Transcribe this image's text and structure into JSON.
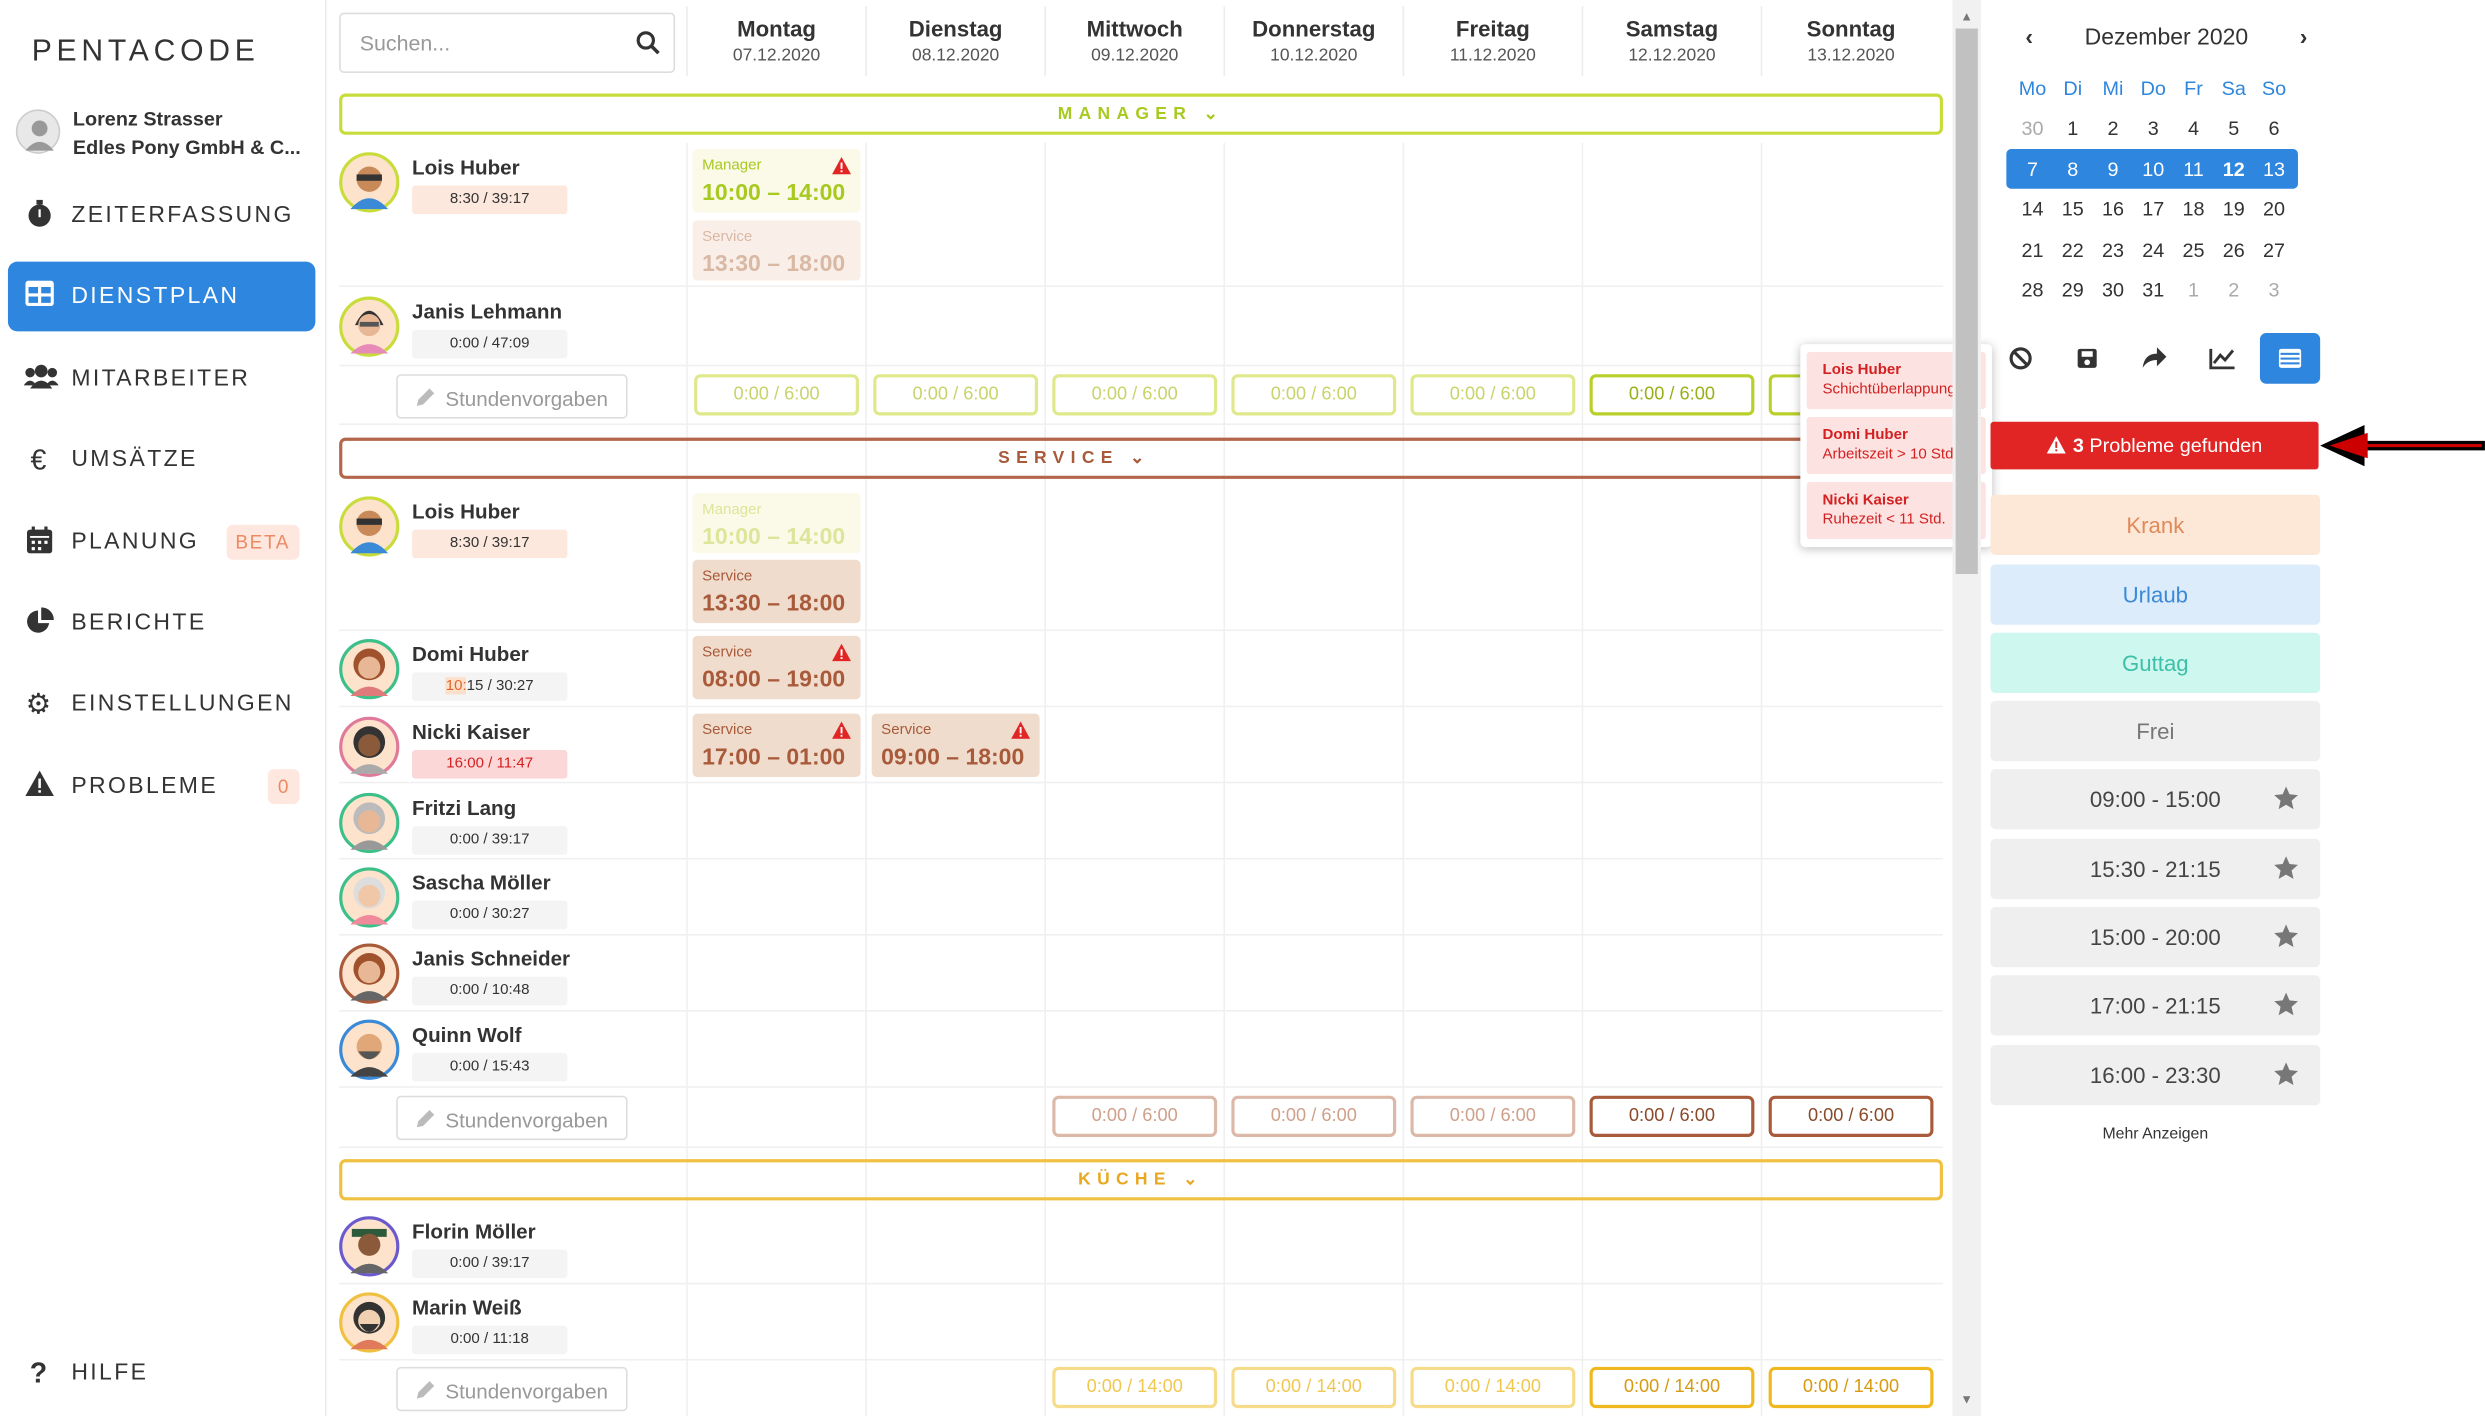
{
  "app": {
    "logo": "PENTACODE"
  },
  "user": {
    "name": "Lorenz Strasser",
    "company": "Edles Pony GmbH & C..."
  },
  "nav": {
    "items": [
      {
        "label": "ZEITERFASSUNG",
        "icon": "stopwatch-icon"
      },
      {
        "label": "DIENSTPLAN",
        "icon": "table-icon",
        "active": true
      },
      {
        "label": "MITARBEITER",
        "icon": "users-icon"
      },
      {
        "label": "UMSÄTZE",
        "icon": "euro-icon"
      },
      {
        "label": "PLANUNG",
        "icon": "calendar-icon",
        "badge": "BETA"
      },
      {
        "label": "BERICHTE",
        "icon": "pie-chart-icon"
      },
      {
        "label": "EINSTELLUNGEN",
        "icon": "gear-icon"
      },
      {
        "label": "PROBLEME",
        "icon": "warning-icon",
        "badge": "0"
      }
    ],
    "help": "HILFE"
  },
  "search": {
    "placeholder": "Suchen..."
  },
  "days": [
    {
      "name": "Montag",
      "date": "07.12.2020"
    },
    {
      "name": "Dienstag",
      "date": "08.12.2020"
    },
    {
      "name": "Mittwoch",
      "date": "09.12.2020"
    },
    {
      "name": "Donnerstag",
      "date": "10.12.2020"
    },
    {
      "name": "Freitag",
      "date": "11.12.2020"
    },
    {
      "name": "Samstag",
      "date": "12.12.2020"
    },
    {
      "name": "Sonntag",
      "date": "13.12.2020"
    }
  ],
  "groups": {
    "manager": {
      "label": "MANAGER",
      "color": "#a8c920"
    },
    "service": {
      "label": "SERVICE",
      "color": "#a85a3a"
    },
    "kueche": {
      "label": "KÜCHE",
      "color": "#f0b820"
    }
  },
  "stundenvorgaben": "Stundenvorgaben",
  "employees": {
    "m_lois": {
      "name": "Lois Huber",
      "hours": "8:30 / 39:17"
    },
    "m_janis": {
      "name": "Janis Lehmann",
      "hours": "0:00 / 47:09"
    },
    "s_lois": {
      "name": "Lois Huber",
      "hours": "8:30 / 39:17"
    },
    "s_domi": {
      "name": "Domi Huber",
      "hours_a": "10:",
      "hours_b": "15 / 30:27"
    },
    "s_nicki": {
      "name": "Nicki Kaiser",
      "hours": "16:00 / 11:47"
    },
    "s_fritzi": {
      "name": "Fritzi Lang",
      "hours": "0:00 / 39:17"
    },
    "s_sascha": {
      "name": "Sascha Möller",
      "hours": "0:00 / 30:27"
    },
    "s_janis": {
      "name": "Janis Schneider",
      "hours": "0:00 / 10:48"
    },
    "s_quinn": {
      "name": "Quinn Wolf",
      "hours": "0:00 / 15:43"
    },
    "k_florin": {
      "name": "Florin Möller",
      "hours": "0:00 / 39:17"
    },
    "k_marin": {
      "name": "Marin Weiß",
      "hours": "0:00 / 11:18"
    }
  },
  "shifts": {
    "m1": {
      "type": "Manager",
      "time": "10:00 – 14:00"
    },
    "m2": {
      "type": "Service",
      "time": "13:30 – 18:00"
    },
    "s1": {
      "type": "Manager",
      "time": "10:00 – 14:00"
    },
    "s2": {
      "type": "Service",
      "time": "13:30 – 18:00"
    },
    "s3": {
      "type": "Service",
      "time": "08:00 – 19:00"
    },
    "s4": {
      "type": "Service",
      "time": "17:00 – 01:00"
    },
    "s5": {
      "type": "Service",
      "time": "09:00 – 18:00"
    }
  },
  "hourboxes": {
    "h6": "0:00 / 6:00",
    "h14": "0:00 / 14:00"
  },
  "calendar": {
    "month": "Dezember 2020",
    "weekdays": [
      "Mo",
      "Di",
      "Mi",
      "Do",
      "Fr",
      "Sa",
      "So"
    ],
    "weeks": [
      [
        "30",
        "1",
        "2",
        "3",
        "4",
        "5",
        "6"
      ],
      [
        "7",
        "8",
        "9",
        "10",
        "11",
        "12",
        "13"
      ],
      [
        "14",
        "15",
        "16",
        "17",
        "18",
        "19",
        "20"
      ],
      [
        "21",
        "22",
        "23",
        "24",
        "25",
        "26",
        "27"
      ],
      [
        "28",
        "29",
        "30",
        "31",
        "1",
        "2",
        "3"
      ]
    ]
  },
  "problems": {
    "count": "3",
    "label": "Probleme gefunden"
  },
  "popover": [
    {
      "name": "Lois Huber",
      "issue": "Schichtüberlappung"
    },
    {
      "name": "Domi Huber",
      "issue": "Arbeitszeit > 10 Std."
    },
    {
      "name": "Nicki Kaiser",
      "issue": "Ruhezeit < 11 Std."
    }
  ],
  "palette": {
    "absences": [
      {
        "label": "Krank",
        "bg": "#fde8d8",
        "fg": "#e08a5a"
      },
      {
        "label": "Urlaub",
        "bg": "#dcecfb",
        "fg": "#3a8ad8"
      },
      {
        "label": "Guttag",
        "bg": "#cdf7ef",
        "fg": "#3dbfa8"
      },
      {
        "label": "Frei",
        "bg": "#efefef",
        "fg": "#777"
      }
    ],
    "templates": [
      "09:00 - 15:00",
      "15:30 - 21:15",
      "15:00 - 20:00",
      "17:00 - 21:15",
      "16:00 - 23:30"
    ],
    "more": "Mehr Anzeigen"
  }
}
